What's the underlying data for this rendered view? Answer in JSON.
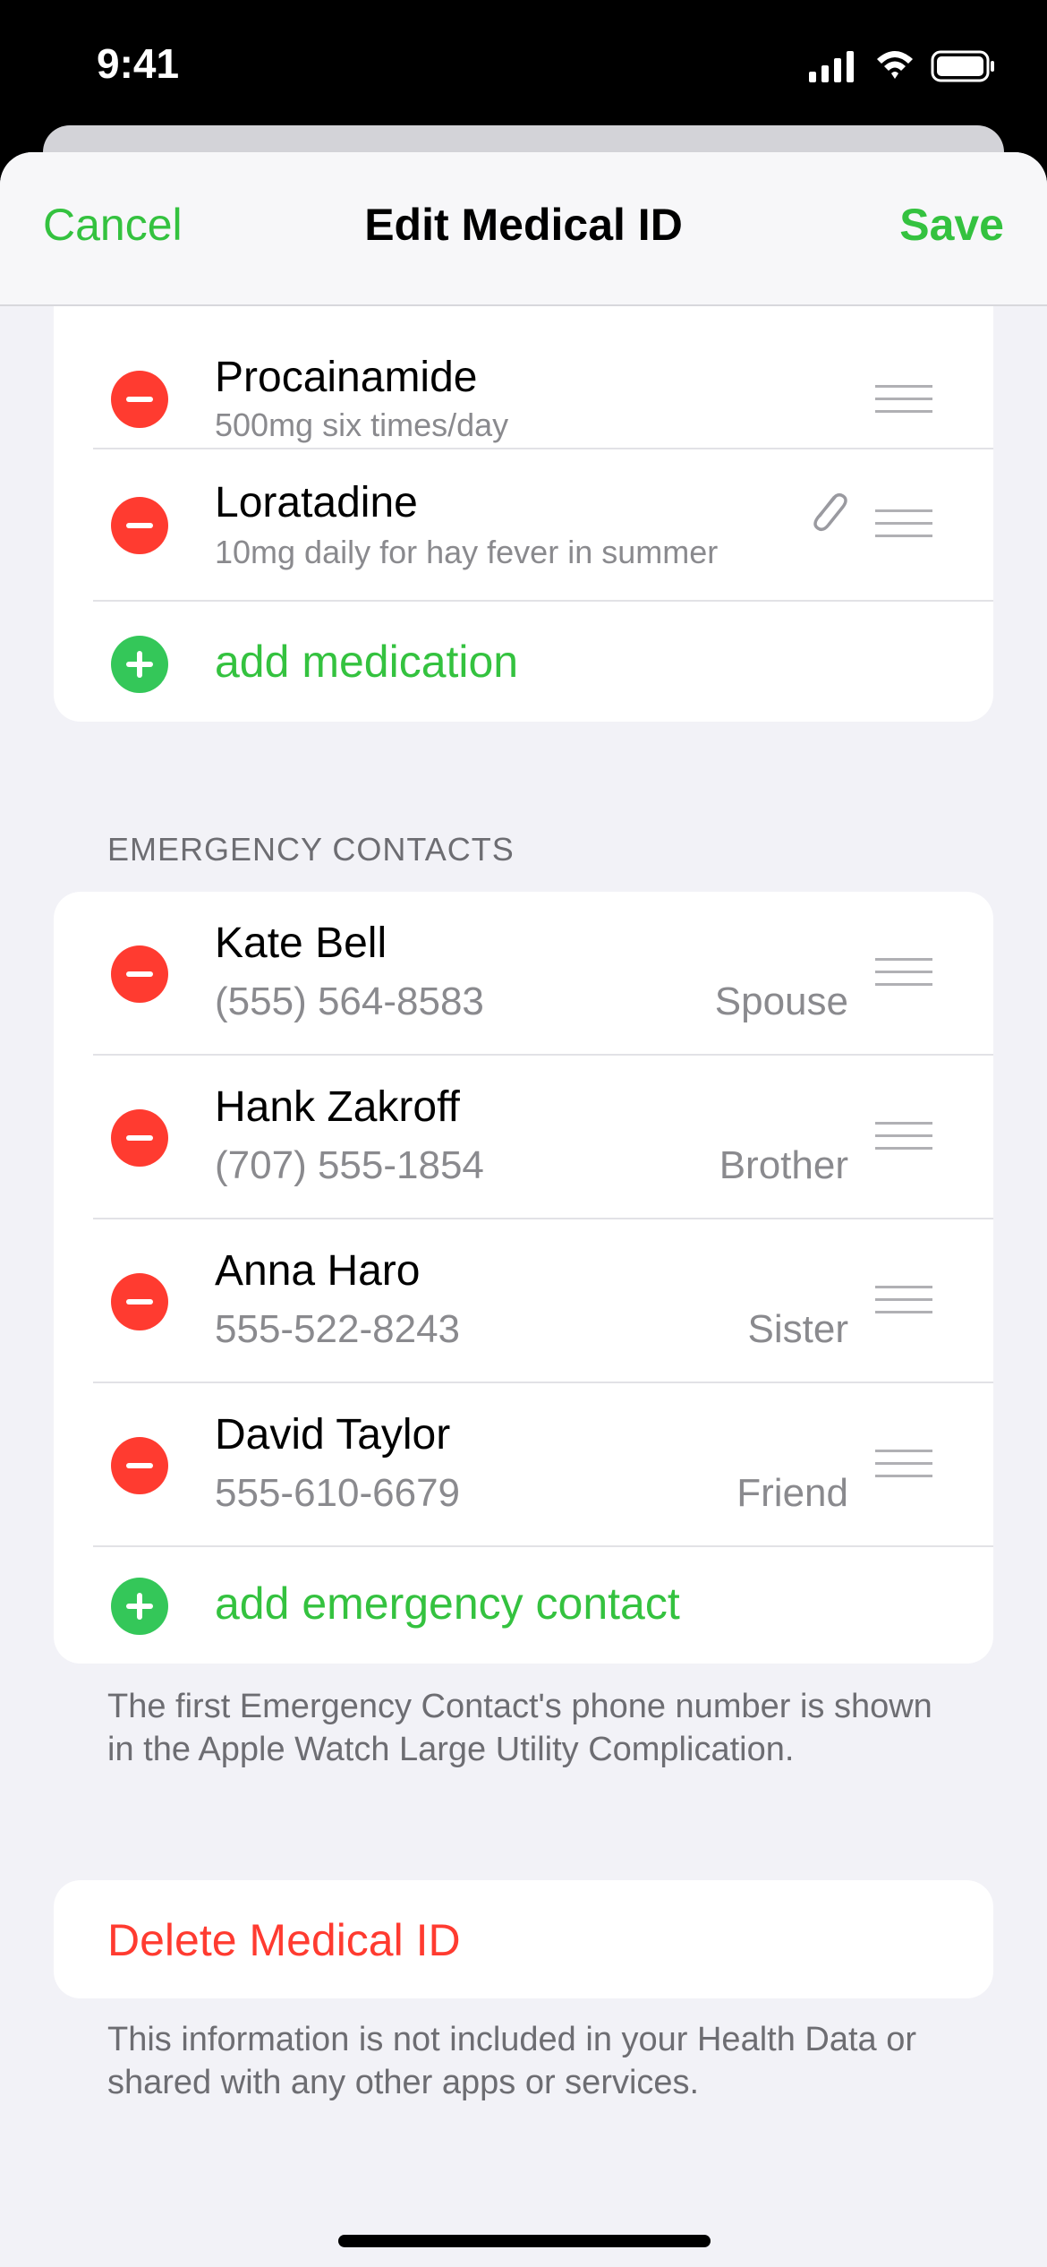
{
  "status_bar": {
    "time": "9:41"
  },
  "nav": {
    "cancel": "Cancel",
    "title": "Edit Medical ID",
    "save": "Save"
  },
  "medications": {
    "items": [
      {
        "name": "Procainamide",
        "dosage": "500mg six times/day",
        "attachment": false
      },
      {
        "name": "Loratadine",
        "dosage": "10mg daily for hay fever in summer",
        "attachment": true
      }
    ],
    "add_label": "add medication"
  },
  "emergency_contacts": {
    "header": "EMERGENCY CONTACTS",
    "items": [
      {
        "name": "Kate Bell",
        "phone": "(555) 564-8583",
        "relationship": "Spouse"
      },
      {
        "name": "Hank Zakroff",
        "phone": "(707) 555-1854",
        "relationship": "Brother"
      },
      {
        "name": "Anna Haro",
        "phone": "555-522-8243",
        "relationship": "Sister"
      },
      {
        "name": "David Taylor",
        "phone": "555-610-6679",
        "relationship": "Friend"
      }
    ],
    "add_label": "add emergency contact",
    "footnote": "The first Emergency Contact's phone number is shown in the Apple Watch Large Utility Complication."
  },
  "delete": {
    "label": "Delete Medical ID"
  },
  "privacy_note": "This information is not included in your Health Data or shared with any other apps or services.",
  "colors": {
    "accent_green": "#34c23f",
    "destructive_red": "#ff3b30",
    "add_green": "#34c759"
  }
}
